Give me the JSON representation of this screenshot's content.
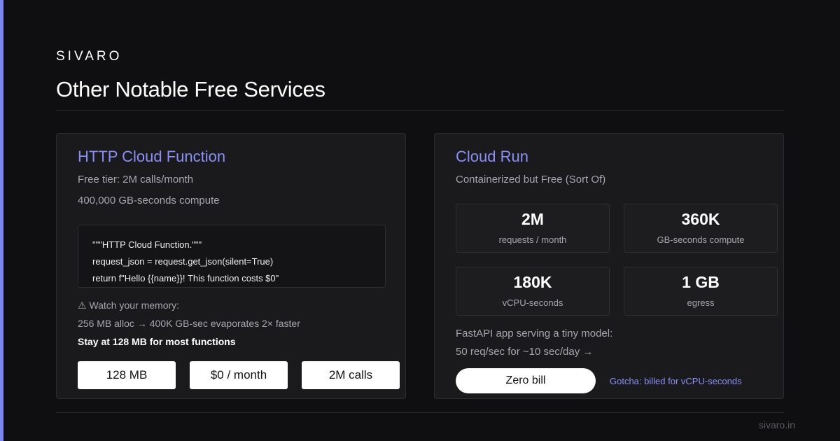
{
  "brand": "SIVARO",
  "title": "Other Notable Free Services",
  "colors": {
    "accent": "#7c83f2",
    "background": "#0f0f11",
    "card": "#1a1a1d"
  },
  "left_card": {
    "title": "HTTP Cloud Function",
    "lines": [
      "Free tier: 2M calls/month",
      "400,000 GB-seconds compute"
    ],
    "code": [
      "\"\"\"HTTP Cloud Function.\"\"\"",
      "request_json = request.get_json(silent=True)",
      "return f\"Hello {{name}}! This function costs $0\""
    ],
    "warning": "⚠ Watch your memory:",
    "warning_detail": "256 MB alloc → 400K GB-sec evaporates 2× faster",
    "recommendation": "Stay at 128 MB for most functions",
    "pills": [
      "128 MB",
      "$0 / month",
      "2M calls"
    ]
  },
  "right_card": {
    "title": "Cloud Run",
    "subtitle": "Containerized but Free (Sort Of)",
    "stats": [
      {
        "value": "2M",
        "label": "requests / month"
      },
      {
        "value": "360K",
        "label": "GB-seconds compute"
      },
      {
        "value": "180K",
        "label": "vCPU-seconds"
      },
      {
        "value": "1 GB",
        "label": "egress"
      }
    ],
    "example_line1": "FastAPI app serving a tiny model:",
    "example_line2": "50 req/sec for ~10 sec/day →",
    "cta": "Zero bill",
    "gotcha": "Gotcha: billed for vCPU-seconds"
  },
  "footer": "sivaro.in"
}
